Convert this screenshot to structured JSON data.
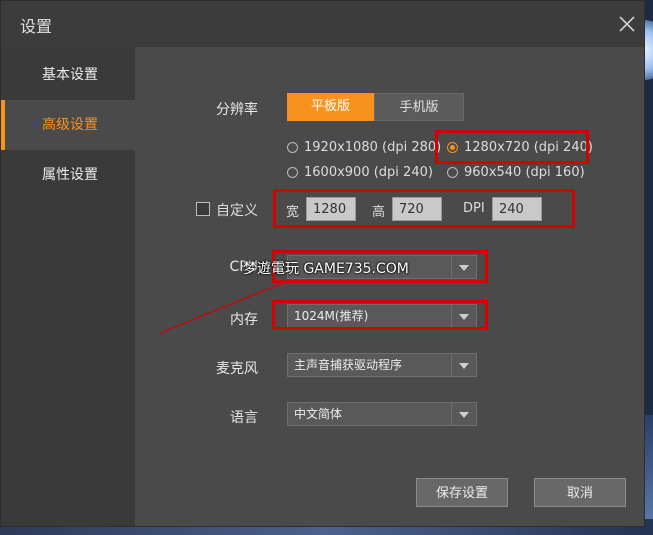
{
  "window": {
    "title": "设置"
  },
  "sidebar": {
    "items": [
      {
        "label": "基本设置"
      },
      {
        "label": "高级设置"
      },
      {
        "label": "属性设置"
      }
    ]
  },
  "resolution": {
    "label": "分辨率",
    "tabs": [
      {
        "label": "平板版",
        "selected": true
      },
      {
        "label": "手机版",
        "selected": false
      }
    ],
    "options": [
      {
        "label": "1920x1080 (dpi 280)",
        "selected": false
      },
      {
        "label": "1280x720 (dpi 240)",
        "selected": true
      },
      {
        "label": "1600x900 (dpi 240)",
        "selected": false
      },
      {
        "label": "960x540 (dpi 160)",
        "selected": false
      }
    ]
  },
  "custom": {
    "label": "自定义",
    "checked": false,
    "width_label": "宽",
    "width_value": "1280",
    "height_label": "高",
    "height_value": "720",
    "dpi_label": "DPI",
    "dpi_value": "240"
  },
  "cpu": {
    "label": "CPU",
    "value": ""
  },
  "memory": {
    "label": "内存",
    "value": "1024M(推荐)"
  },
  "mic": {
    "label": "麦克风",
    "value": "主声音捕获驱动程序"
  },
  "language": {
    "label": "语言",
    "value": "中文简体"
  },
  "buttons": {
    "save": "保存设置",
    "cancel": "取消"
  },
  "watermark": {
    "text": "梦遊電玩 GAME735.COM"
  },
  "colors": {
    "accent": "#f7921e",
    "highlight": "#d50000",
    "panel": "#4a4a4a"
  }
}
